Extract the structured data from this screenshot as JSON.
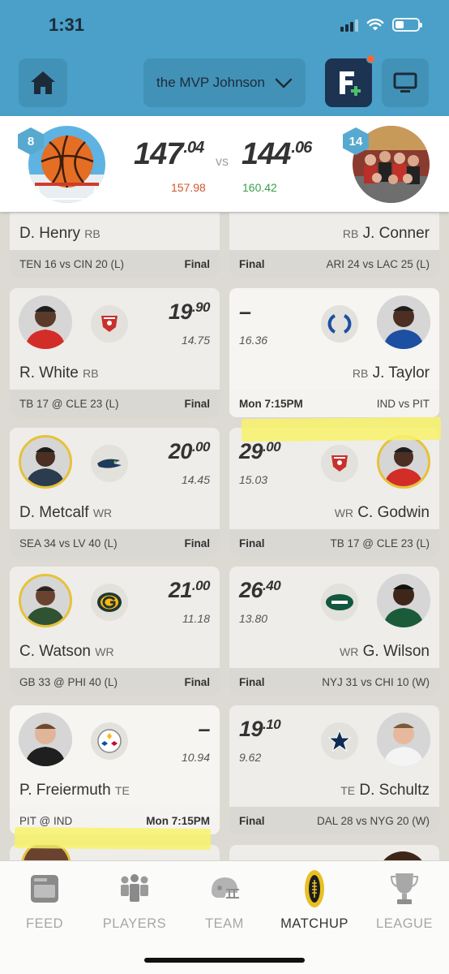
{
  "status_bar": {
    "time": "1:31"
  },
  "header": {
    "team_name": "the MVP Johnson"
  },
  "scoreboard": {
    "my_rank": "8",
    "my_score_int": "147",
    "my_score_dec": ".04",
    "my_projection": "157.98",
    "vs": "vs",
    "opp_score_int": "144",
    "opp_score_dec": ".06",
    "opp_projection": "160.42",
    "opp_rank": "14"
  },
  "colors": {
    "header": "#4aa0c8",
    "proj_low": "#d2552e",
    "proj_high": "#3aa048",
    "highlight": "#f8f26a"
  },
  "matchups": [
    {
      "left": {
        "name": "D. Henry",
        "pos": "RB",
        "game": "TEN 16 vs CIN 20 (L)",
        "status": "Final"
      },
      "right": {
        "name": "J. Conner",
        "pos": "RB",
        "game": "ARI 24 vs LAC 25 (L)",
        "status": "Final"
      }
    },
    {
      "left": {
        "name": "R. White",
        "pos": "RB",
        "pts_int": "19",
        "pts_dec": ".90",
        "proj": "14.75",
        "team_logo": "buccaneers-logo",
        "game": "TB 17 @ CLE 23 (L)",
        "status": "Final"
      },
      "right": {
        "name": "J. Taylor",
        "pos": "RB",
        "pts": "–",
        "proj": "16.36",
        "team_logo": "colts-logo",
        "game": "IND vs PIT",
        "status": "Mon 7:15PM"
      }
    },
    {
      "left": {
        "name": "D. Metcalf",
        "pos": "WR",
        "pts_int": "20",
        "pts_dec": ".00",
        "proj": "14.45",
        "team_logo": "seahawks-logo",
        "game": "SEA 34 vs LV 40 (L)",
        "status": "Final"
      },
      "right": {
        "name": "C. Godwin",
        "pos": "WR",
        "pts_int": "29",
        "pts_dec": ".00",
        "proj": "15.03",
        "team_logo": "buccaneers-logo",
        "game": "TB 17 @ CLE 23 (L)",
        "status": "Final"
      }
    },
    {
      "left": {
        "name": "C. Watson",
        "pos": "WR",
        "pts_int": "21",
        "pts_dec": ".00",
        "proj": "11.18",
        "team_logo": "packers-logo",
        "game": "GB 33 @ PHI 40 (L)",
        "status": "Final"
      },
      "right": {
        "name": "G. Wilson",
        "pos": "WR",
        "pts_int": "26",
        "pts_dec": ".40",
        "proj": "13.80",
        "team_logo": "jets-logo",
        "game": "NYJ 31 vs CHI 10 (W)",
        "status": "Final"
      }
    },
    {
      "left": {
        "name": "P. Freiermuth",
        "pos": "TE",
        "pts": "–",
        "proj": "10.94",
        "team_logo": "steelers-logo",
        "game": "PIT @ IND",
        "status": "Mon 7:15PM"
      },
      "right": {
        "name": "D. Schultz",
        "pos": "TE",
        "pts_int": "19",
        "pts_dec": ".10",
        "proj": "9.62",
        "team_logo": "cowboys-logo",
        "game": "DAL 28 vs NYG 20 (W)",
        "status": "Final"
      }
    }
  ],
  "tabs": [
    {
      "label": "FEED",
      "icon": "feed-icon"
    },
    {
      "label": "PLAYERS",
      "icon": "players-icon"
    },
    {
      "label": "TEAM",
      "icon": "helmet-icon"
    },
    {
      "label": "MATCHUP",
      "icon": "football-icon",
      "active": true
    },
    {
      "label": "LEAGUE",
      "icon": "trophy-icon"
    }
  ]
}
